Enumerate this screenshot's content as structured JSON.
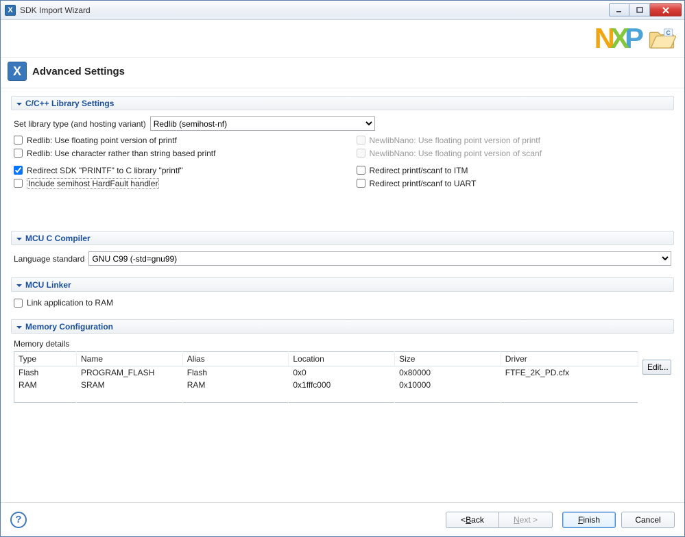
{
  "window": {
    "title": "SDK Import Wizard"
  },
  "header": {
    "title": "Advanced Settings"
  },
  "sections": {
    "library": {
      "title": "C/C++ Library Settings",
      "set_library_label": "Set library type (and hosting variant)",
      "library_options": [
        "Redlib (semihost-nf)"
      ],
      "library_value": "Redlib (semihost-nf)",
      "checks": {
        "redlib_float_printf": "Redlib: Use floating point version of printf",
        "redlib_char_printf": "Redlib: Use character rather than string based printf",
        "newlibnano_float_printf": "NewlibNano: Use floating point version of printf",
        "newlibnano_float_scanf": "NewlibNano: Use floating point version of scanf",
        "redirect_sdk_printf": "Redirect SDK \"PRINTF\" to C library \"printf\"",
        "include_semihost_handler": "Include semihost HardFault handler",
        "redirect_itm": "Redirect printf/scanf to ITM",
        "redirect_uart": "Redirect printf/scanf to UART"
      }
    },
    "compiler": {
      "title": "MCU C Compiler",
      "lang_label": "Language standard",
      "lang_options": [
        "GNU C99 (-std=gnu99)"
      ],
      "lang_value": "GNU C99 (-std=gnu99)"
    },
    "linker": {
      "title": "MCU Linker",
      "link_ram": "Link application to RAM"
    },
    "memory": {
      "title": "Memory Configuration",
      "details_label": "Memory details",
      "columns": [
        "Type",
        "Name",
        "Alias",
        "Location",
        "Size",
        "Driver"
      ],
      "rows": [
        {
          "type": "Flash",
          "name": "PROGRAM_FLASH",
          "alias": "Flash",
          "location": "0x0",
          "size": "0x80000",
          "driver": "FTFE_2K_PD.cfx"
        },
        {
          "type": "RAM",
          "name": "SRAM",
          "alias": "RAM",
          "location": "0x1fffc000",
          "size": "0x10000",
          "driver": ""
        }
      ],
      "edit_btn": "Edit..."
    }
  },
  "footer": {
    "back": "< Back",
    "next": "Next >",
    "finish": "Finish",
    "cancel": "Cancel"
  }
}
